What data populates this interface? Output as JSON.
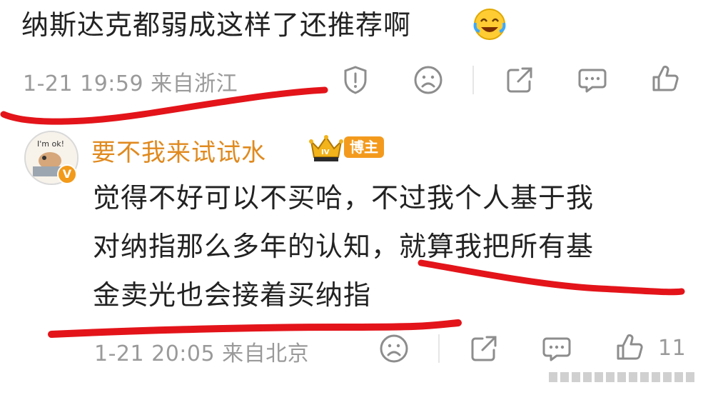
{
  "comment1": {
    "text": "纳斯达克都弱成这样了还推荐啊",
    "meta": "1-21 19:59  来自浙江"
  },
  "comment2": {
    "username": "要不我来试试水",
    "badge": "博主",
    "text": [
      "觉得不好可以不买哈，不过我个人基于我",
      "对纳指那么多年的认知，就算我把所有基",
      "金卖光也会接着买纳指"
    ],
    "meta": "1-21 20:05  来自北京",
    "like_count": "11"
  },
  "icons": {
    "report": "shield-icon",
    "dislike": "sad-face-icon",
    "share": "share-icon",
    "comment": "comment-icon",
    "like": "thumbs-up-icon",
    "emoji": "laughing-crying-emoji-icon",
    "crown": "crown-icon",
    "verified": "v-badge-icon"
  },
  "colors": {
    "username": "#e08a1f",
    "badge_bg": "#f39a1d",
    "annotation_red": "#e3141a",
    "meta_gray": "#9a9a9a"
  }
}
